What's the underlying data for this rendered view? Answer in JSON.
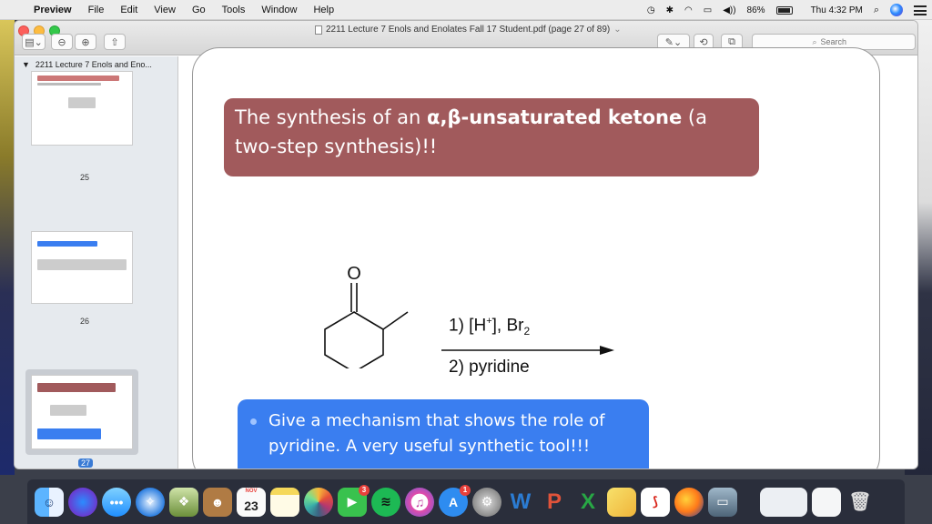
{
  "menubar": {
    "app_name": "Preview",
    "menus": [
      "File",
      "Edit",
      "View",
      "Go",
      "Tools",
      "Window",
      "Help"
    ],
    "battery": "86%",
    "clock": "Thu 4:32 PM"
  },
  "window": {
    "title": "2211 Lecture 7 Enols and Enolates Fall 17 Student.pdf (page 27 of 89)",
    "title_chevron": "⌄",
    "search_placeholder": "Search"
  },
  "sidebar": {
    "doc_name": "2211 Lecture 7 Enols and Eno...",
    "pages": [
      {
        "number": "25",
        "selected": false
      },
      {
        "number": "26",
        "selected": false
      },
      {
        "number": "27",
        "selected": true
      }
    ]
  },
  "slide": {
    "title_plain_1": "The synthesis of an ",
    "title_bold": "α,β-unsaturated ketone",
    "title_plain_2": " (a two-step synthesis)!!",
    "reagent_1_prefix": "1) [H",
    "reagent_1_sup": "+",
    "reagent_1_mid": "], Br",
    "reagent_1_sub": "2",
    "reagent_2": "2) pyridine",
    "carbonyl_oxygen": "O",
    "callout": "Give a mechanism that shows the role of pyridine. A very useful synthetic tool!!!"
  },
  "dock": {
    "calendar_month": "NOV",
    "calendar_day": "23",
    "badges": {
      "facetime": "3",
      "appstore": "1"
    }
  },
  "colors": {
    "title_box": "#a15a5c",
    "callout_box": "#3a7ef0",
    "selection": "#3a7bd5"
  }
}
